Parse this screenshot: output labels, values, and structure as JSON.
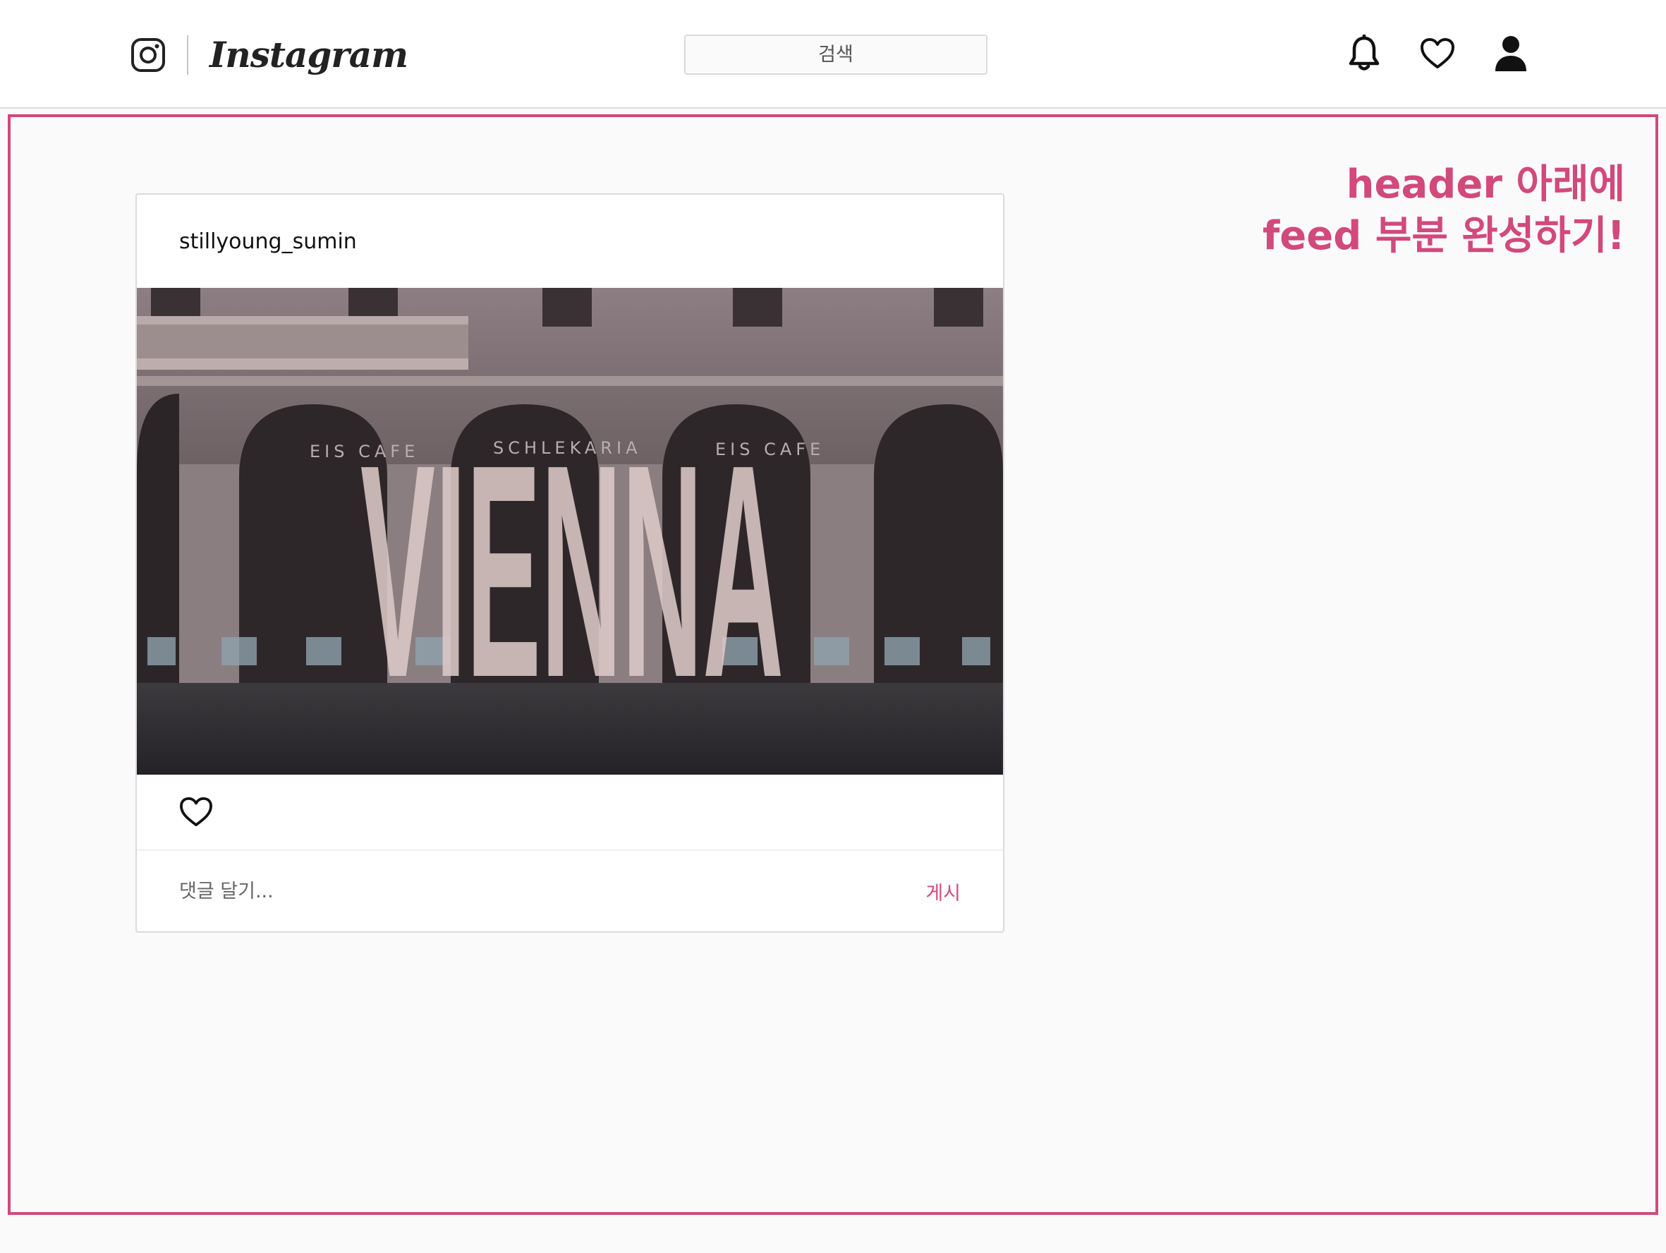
{
  "header": {
    "logo_text": "Instagram",
    "search_placeholder": "검색",
    "icons": [
      "instagram-glyph-icon",
      "bell-icon",
      "heart-icon",
      "person-icon"
    ]
  },
  "annotation": {
    "line1": "header 아래에",
    "line2": "feed 부분 완성하기!",
    "color": "#d2497b"
  },
  "feed": {
    "username": "stillyoung_sumin",
    "photo": {
      "title": "VIENNA",
      "signs": [
        "EIS CAFE",
        "SCHLEKARIA",
        "EIS CAFE"
      ]
    },
    "comment_placeholder": "댓글 달기...",
    "post_label": "게시"
  },
  "colors": {
    "accent": "#d2497b",
    "border": "#dbdbdb",
    "background": "#fafafa"
  }
}
